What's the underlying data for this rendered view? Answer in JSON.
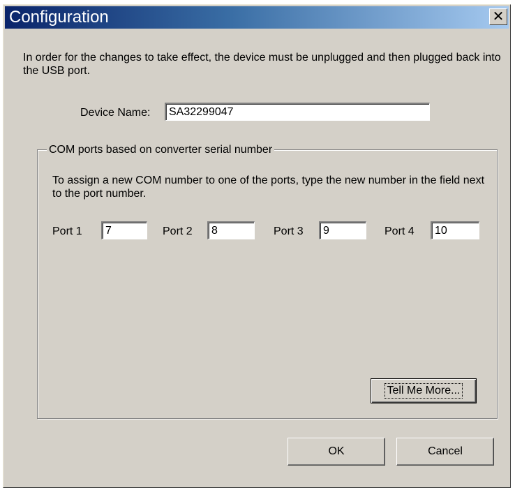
{
  "window": {
    "title": "Configuration",
    "close_symbol": "✕"
  },
  "intro": {
    "text": "In order for the changes to take effect, the device must be unplugged and then plugged back into the USB port."
  },
  "device_name": {
    "label": "Device Name:",
    "value": "SA32299047"
  },
  "com_group": {
    "legend": "COM ports based on converter serial number",
    "description": "To assign a new COM number to one of the ports, type the new number in the field next to the port number.",
    "ports": [
      {
        "label": "Port 1",
        "value": "7"
      },
      {
        "label": "Port 2",
        "value": "8"
      },
      {
        "label": "Port 3",
        "value": "9"
      },
      {
        "label": "Port 4",
        "value": "10"
      }
    ],
    "tell_me_more_label": "Tell Me More..."
  },
  "buttons": {
    "ok_label": "OK",
    "cancel_label": "Cancel"
  },
  "colors": {
    "dialog_face": "#d4d0c8",
    "titlebar_start": "#0a246a",
    "titlebar_end": "#a6caf0",
    "title_text": "#ffffff"
  }
}
